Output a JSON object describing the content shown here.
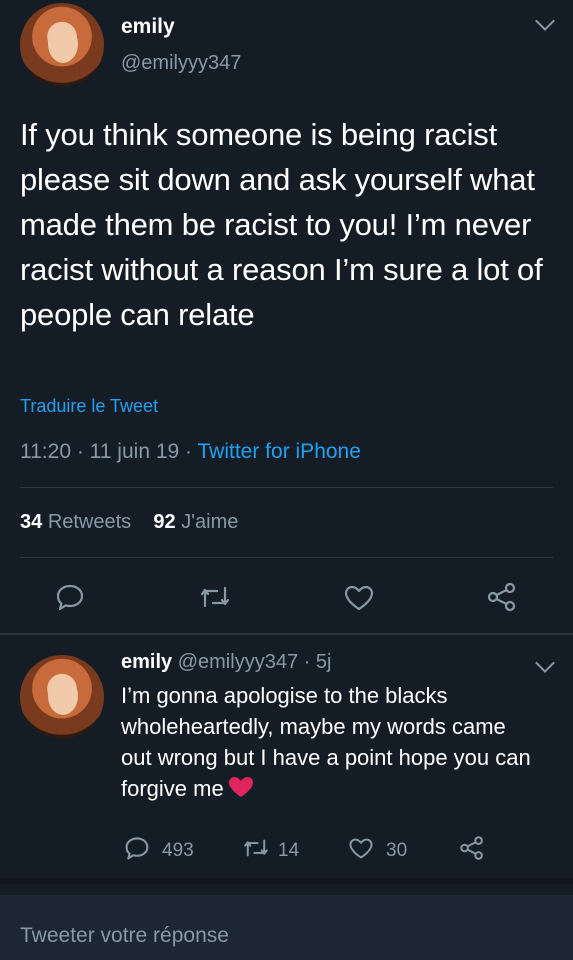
{
  "tweet": {
    "author_name": "emily",
    "author_handle": "@emilyyy347",
    "text": "If you think someone is being racist please sit down and ask yourself what made them be racist to you! I’m never racist without a reason I’m sure a lot of people can relate",
    "translate_label": "Traduire le Tweet",
    "time": "11:20",
    "date": "11 juin 19",
    "source": "Twitter for iPhone",
    "retweets_count": "34",
    "retweets_label": "Retweets",
    "likes_count": "92",
    "likes_label": "J'aime"
  },
  "reply": {
    "author_name": "emily",
    "author_handle": "@emilyyy347",
    "age": "5j",
    "text": "I’m gonna apologise to the blacks wholeheartedly, maybe my words came out wrong but I have a point hope you can forgive me",
    "replies": "493",
    "retweets": "14",
    "likes": "30"
  },
  "composer": {
    "placeholder": "Tweeter votre réponse"
  },
  "colors": {
    "background": "#141d26",
    "accent": "#1da1f2",
    "muted": "#8899a6",
    "heart": "#e0245e"
  },
  "icons": [
    "chevron-down-icon",
    "reply-icon",
    "retweet-icon",
    "like-icon",
    "share-icon",
    "red-heart-emoji"
  ]
}
